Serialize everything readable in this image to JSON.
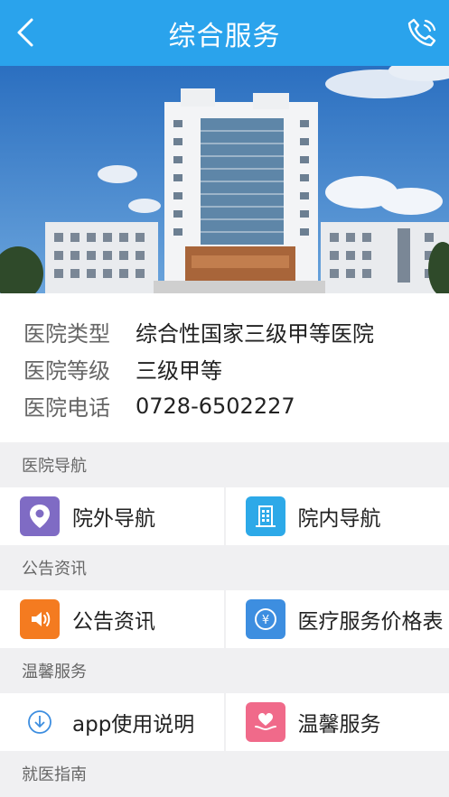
{
  "header": {
    "title": "综合服务",
    "back_icon": "back-chevron-icon",
    "phone_icon": "phone-icon"
  },
  "colors": {
    "nav": "#2aa3ec",
    "purple": "#7f6bc4",
    "blue": "#2da9e8",
    "orange": "#f47b20",
    "royal": "#3d8ee0",
    "pink": "#f06a8a"
  },
  "info": [
    {
      "key": "医院类型",
      "value": "综合性国家三级甲等医院"
    },
    {
      "key": "医院等级",
      "value": "三级甲等"
    },
    {
      "key": "医院电话",
      "value": "0728-6502227"
    }
  ],
  "sections": [
    {
      "title": "医院导航",
      "items": [
        {
          "label": "院外导航",
          "icon": "location-pin-icon"
        },
        {
          "label": "院内导航",
          "icon": "building-icon"
        }
      ]
    },
    {
      "title": "公告资讯",
      "items": [
        {
          "label": "公告资讯",
          "icon": "speaker-icon"
        },
        {
          "label": "医疗服务价格表",
          "icon": "price-icon"
        }
      ]
    },
    {
      "title": "温馨服务",
      "items": [
        {
          "label": "app使用说明",
          "icon": "download-icon"
        },
        {
          "label": "温馨服务",
          "icon": "heart-hand-icon"
        }
      ]
    },
    {
      "title": "就医指南",
      "items": []
    }
  ]
}
